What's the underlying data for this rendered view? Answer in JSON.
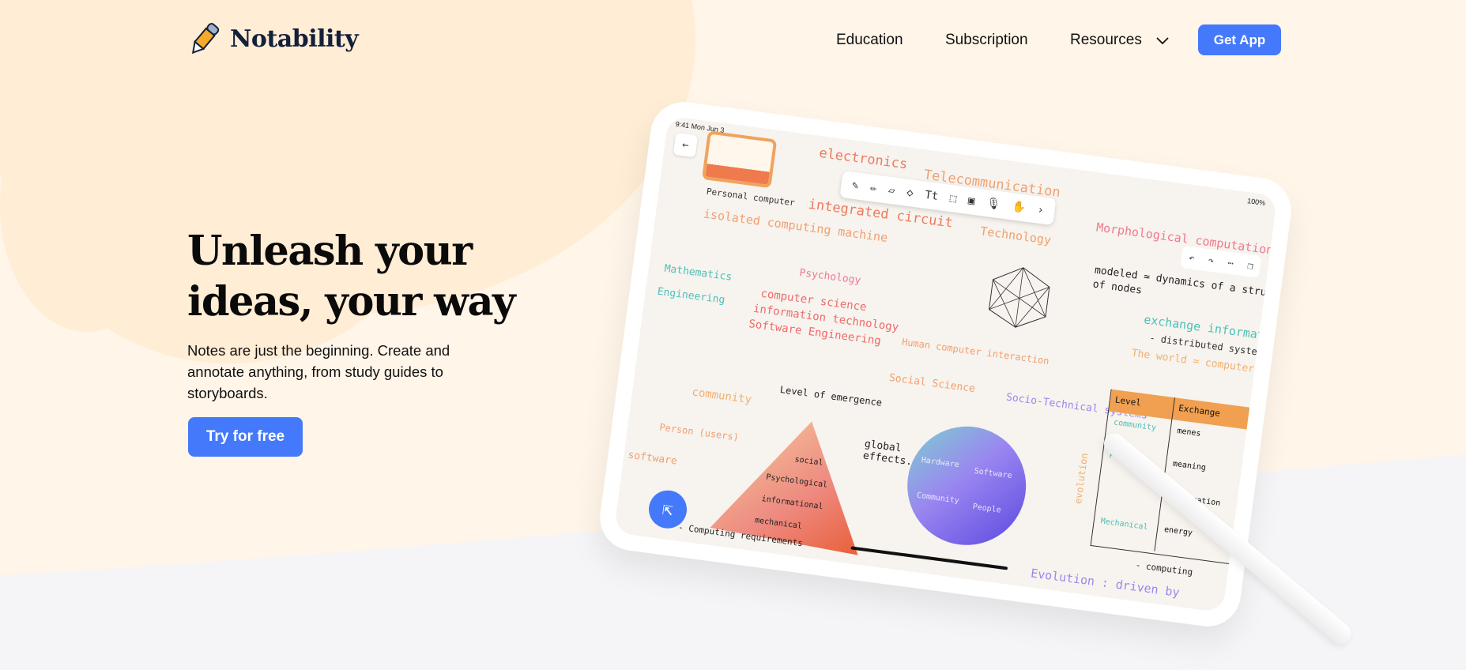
{
  "nav": {
    "brand": "Notability",
    "links": [
      "Education",
      "Subscription",
      "Resources"
    ],
    "cta": "Get App"
  },
  "hero": {
    "title_line1": "Unleash your",
    "title_line2": "ideas, your way",
    "subtitle": "Notes are just the beginning. Create and annotate anything, from study guides to storyboards.",
    "cta": "Try for free"
  },
  "tablet": {
    "status_time": "9:41 Mon Jun 3",
    "battery": "100%",
    "notes": {
      "electronics": "electronics",
      "teleco": "Telecommunication",
      "circuit": "integrated circuit",
      "technology": "Technology",
      "morph": "Morphological computation",
      "pc": "Personal computer",
      "isolated": "isolated computing machine",
      "modeled": "modeled ≃ dynamics of a structure",
      "nodes": "of nodes",
      "exchange": "exchange information",
      "distributed": "- distributed systems",
      "world": "The world ≃ computer",
      "psychology": "Psychology",
      "math": "Mathematics",
      "engineering": "Engineering",
      "cs": "computer science",
      "it": "information technology",
      "se": "Software Engineering",
      "hci": "Human computer interaction",
      "social_science": "Social Science",
      "socio": "Socio-Technical systems",
      "emergence": "Level of emergence",
      "community": "community",
      "person": "Person (users)",
      "software": "software",
      "global": "global effects.",
      "pyramid": [
        "social",
        "Psychological",
        "informational",
        "mechanical"
      ],
      "globe": [
        "Hardware",
        "Software",
        "Community",
        "People"
      ],
      "table_headers": [
        "Level",
        "Exchange"
      ],
      "table_rows": [
        [
          "community",
          "menes"
        ],
        [
          "Personal",
          "meaning"
        ],
        [
          "",
          "information"
        ],
        [
          "Mechanical",
          "energy"
        ]
      ],
      "evolution_axis": "evolution",
      "computing_req": "- Computing requirements",
      "computing": "- computing",
      "evolution": "Evolution : driven by"
    }
  },
  "colors": {
    "accent": "#4479fb",
    "peach": "#fff5e8",
    "cloud": "#ffedd5",
    "gray": "#f5f5f7"
  }
}
